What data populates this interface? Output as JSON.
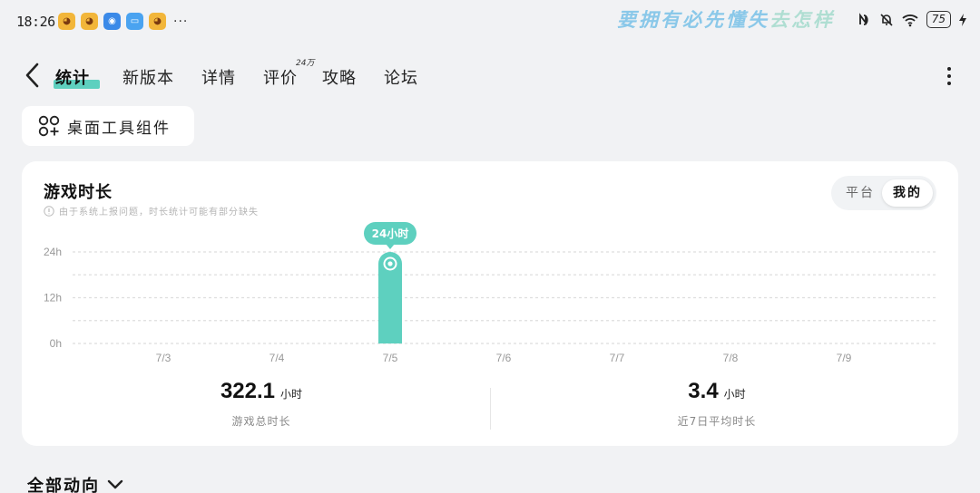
{
  "status_bar": {
    "time": "18:26",
    "watermark_main": "要拥有必先懂失",
    "watermark_tail": "去怎样",
    "battery": "75",
    "app_icons": [
      "face-app-icon",
      "face-app-icon",
      "compass-app-icon",
      "chat-app-icon",
      "face-app-icon"
    ],
    "more": "···"
  },
  "nav": {
    "tabs": [
      {
        "label": "统计",
        "active": true
      },
      {
        "label": "新版本",
        "active": false
      },
      {
        "label": "详情",
        "active": false
      },
      {
        "label": "评价",
        "active": false
      },
      {
        "label": "攻略",
        "active": false
      },
      {
        "label": "论坛",
        "active": false
      }
    ],
    "review_badge": "24万"
  },
  "widget_button": {
    "label": "桌面工具组件",
    "icon": "widgets-icon"
  },
  "card": {
    "title": "游戏时长",
    "note": "由于系统上报问题，时长统计可能有部分缺失",
    "toggle": {
      "options": [
        "平台",
        "我的"
      ],
      "selected": "我的"
    },
    "stats": [
      {
        "value": "322.1",
        "unit": "小时",
        "label": "游戏总时长"
      },
      {
        "value": "3.4",
        "unit": "小时",
        "label": "近7日平均时长"
      }
    ]
  },
  "chart_data": {
    "type": "bar",
    "categories": [
      "7/3",
      "7/4",
      "7/5",
      "7/6",
      "7/7",
      "7/8",
      "7/9"
    ],
    "values": [
      0,
      0,
      24,
      0,
      0,
      0,
      0
    ],
    "ylim": [
      0,
      24
    ],
    "yticks": [
      "0h",
      "12h",
      "24h"
    ],
    "highlight_label": "24小时",
    "highlight_index": 2,
    "bar_color": "#5ed0bf",
    "grid": true
  },
  "footer": {
    "all_activity_label": "全部动向"
  },
  "colors": {
    "accent": "#5ed0bf",
    "background": "#f1f2f4",
    "card": "#ffffff"
  }
}
